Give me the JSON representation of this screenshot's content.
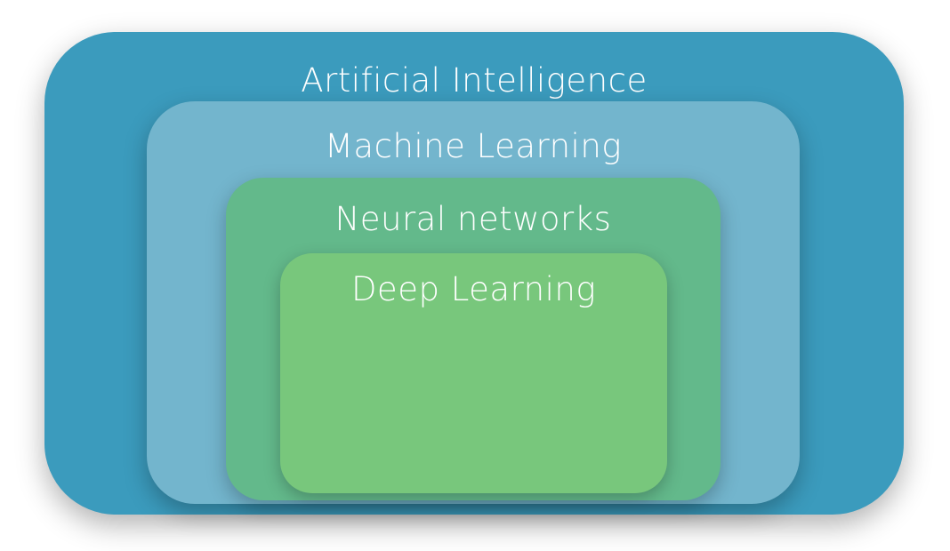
{
  "layers": {
    "artificial_intelligence": {
      "label": "Artificial Intelligence",
      "color": "#3b9bbd"
    },
    "machine_learning": {
      "label": "Machine Learning",
      "color": "#73b5cd"
    },
    "neural_networks": {
      "label": "Neural networks",
      "color": "#63b98b"
    },
    "deep_learning": {
      "label": "Deep Learning",
      "color": "#78c77c"
    }
  }
}
